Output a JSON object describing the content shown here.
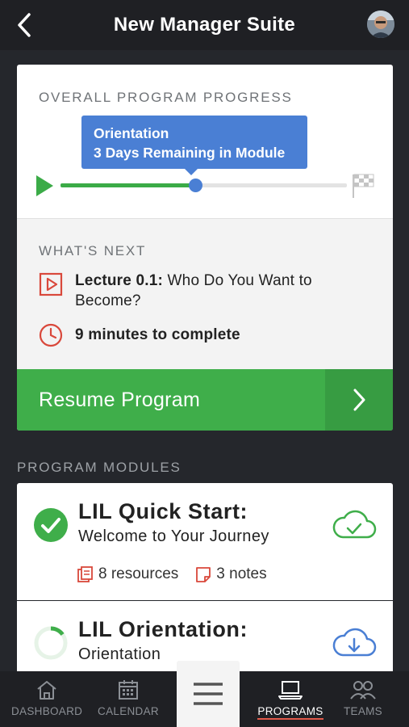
{
  "header": {
    "title": "New Manager Suite"
  },
  "progress_card": {
    "section_label": "OVERALL PROGRAM PROGRESS",
    "tooltip_line1": "Orientation",
    "tooltip_line2": "3 Days Remaining in Module",
    "progress_fraction": 0.47,
    "whats_next_label": "WHAT'S NEXT",
    "lecture_prefix": "Lecture 0.1:",
    "lecture_title": " Who Do You Want to Become?",
    "time_text": "9 minutes to complete",
    "resume_label": "Resume Program"
  },
  "modules": {
    "section_label": "PROGRAM MODULES",
    "items": [
      {
        "title": "LIL Quick Start:",
        "subtitle": "Welcome to Your Journey",
        "resources": "8 resources",
        "notes": "3 notes",
        "status": "complete",
        "cloud_icon": "cloud-check-icon"
      },
      {
        "title": "LIL Orientation:",
        "subtitle": "Orientation",
        "status": "in-progress",
        "progress_fraction": 0.15,
        "cloud_icon": "cloud-download-icon"
      }
    ]
  },
  "bottom_nav": {
    "items": [
      {
        "label": "DASHBOARD",
        "icon": "home-icon"
      },
      {
        "label": "CALENDAR",
        "icon": "calendar-icon"
      },
      {
        "label": "PROGRAMS",
        "icon": "laptop-icon",
        "active": true
      },
      {
        "label": "TEAMS",
        "icon": "people-icon"
      }
    ],
    "menu_icon": "hamburger-icon"
  },
  "colors": {
    "accent_green": "#3fae4a",
    "accent_blue": "#4a7fd4",
    "accent_red": "#d9483b",
    "nav_bg": "#1f2024"
  }
}
